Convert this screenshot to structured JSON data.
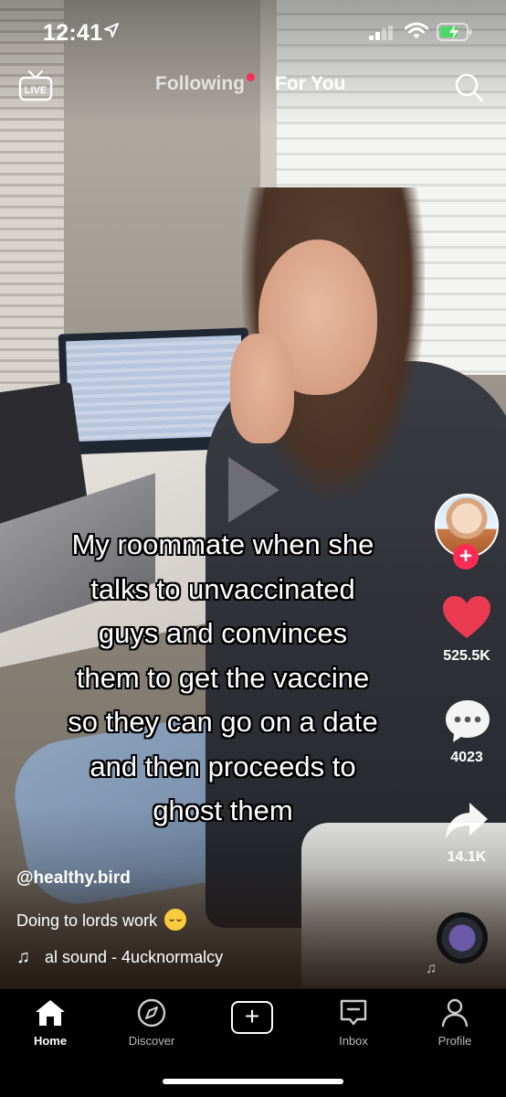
{
  "status_bar": {
    "time": "12:41"
  },
  "top_nav": {
    "live_label": "LIVE",
    "following_label": "Following",
    "for_you_label": "For You",
    "accent_color": "#fe2c55"
  },
  "video": {
    "caption": "My roommate when she\ntalks to unvaccinated\nguys and convinces\nthem to get the vaccine\nso they can go on a date\nand then proceeds to\nghost them",
    "username": "@healthy.bird",
    "description": "Doing to lords work",
    "description_emoji": "relieved-face",
    "sound": "al sound - 4ucknormalcy"
  },
  "actions": {
    "likes": "525.5K",
    "comments": "4023",
    "shares": "14.1K",
    "like_color": "#ea3b52"
  },
  "tab_bar": {
    "items": [
      {
        "label": "Home",
        "icon": "home-icon",
        "active": true
      },
      {
        "label": "Discover",
        "icon": "compass-icon",
        "active": false
      },
      {
        "label": "",
        "icon": "create-plus-icon",
        "active": false
      },
      {
        "label": "Inbox",
        "icon": "inbox-icon",
        "active": false
      },
      {
        "label": "Profile",
        "icon": "profile-icon",
        "active": false
      }
    ]
  }
}
